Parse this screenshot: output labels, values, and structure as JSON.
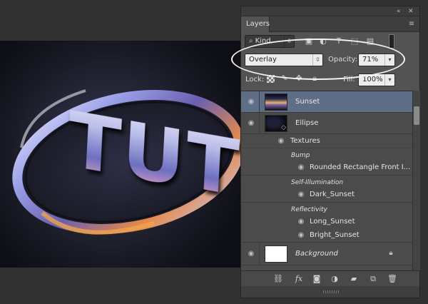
{
  "panel": {
    "title_tab": "Layers",
    "filter": {
      "kind_label": "Kind"
    },
    "blend_mode": "Overlay",
    "opacity_label": "Opacity:",
    "opacity_value": "71%",
    "lock_label": "Lock:",
    "fill_label": "Fill:",
    "fill_value": "100%"
  },
  "layers": {
    "sunset": {
      "name": "Sunset"
    },
    "ellipse": {
      "name": "Ellipse"
    },
    "textures": "Textures",
    "bump_group": "Bump",
    "bump_item": "Rounded Rectangle Front I...",
    "self_illum_group": "Self-Illumination",
    "self_illum_item": "Dark_Sunset",
    "reflectivity_group": "Reflectivity",
    "refl_item_1": "Long_Sunset",
    "refl_item_2": "Bright_Sunset",
    "background": {
      "name": "Background"
    }
  },
  "canvas": {
    "logo_text": "TUTS"
  },
  "colors": {
    "panel_bg": "#535353",
    "selected_row": "#5e6e86",
    "workspace": "#323232"
  }
}
